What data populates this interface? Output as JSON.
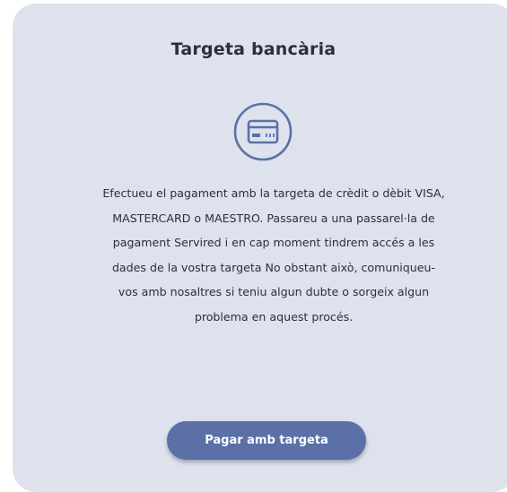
{
  "card": {
    "title": "Targeta bancària",
    "icon": "credit-card-icon",
    "description_lines": [
      "Efectueu el pagament amb la targeta de crèdit o dèbit VISA,",
      "MASTERCARD o MAESTRO. Passareu a una passarel·la de",
      "pagament Servired i en cap moment tindrem accés a les",
      "dades de la vostra targeta No obstant això, comuniqueu-",
      "vos amb nosaltres si teniu algun dubte o sorgeix algun",
      "problema en aquest procés."
    ],
    "button_label": "Pagar amb targeta"
  },
  "colors": {
    "card_background": "#dde2ec",
    "accent": "#5b70a7",
    "text": "#2b2f3a"
  }
}
